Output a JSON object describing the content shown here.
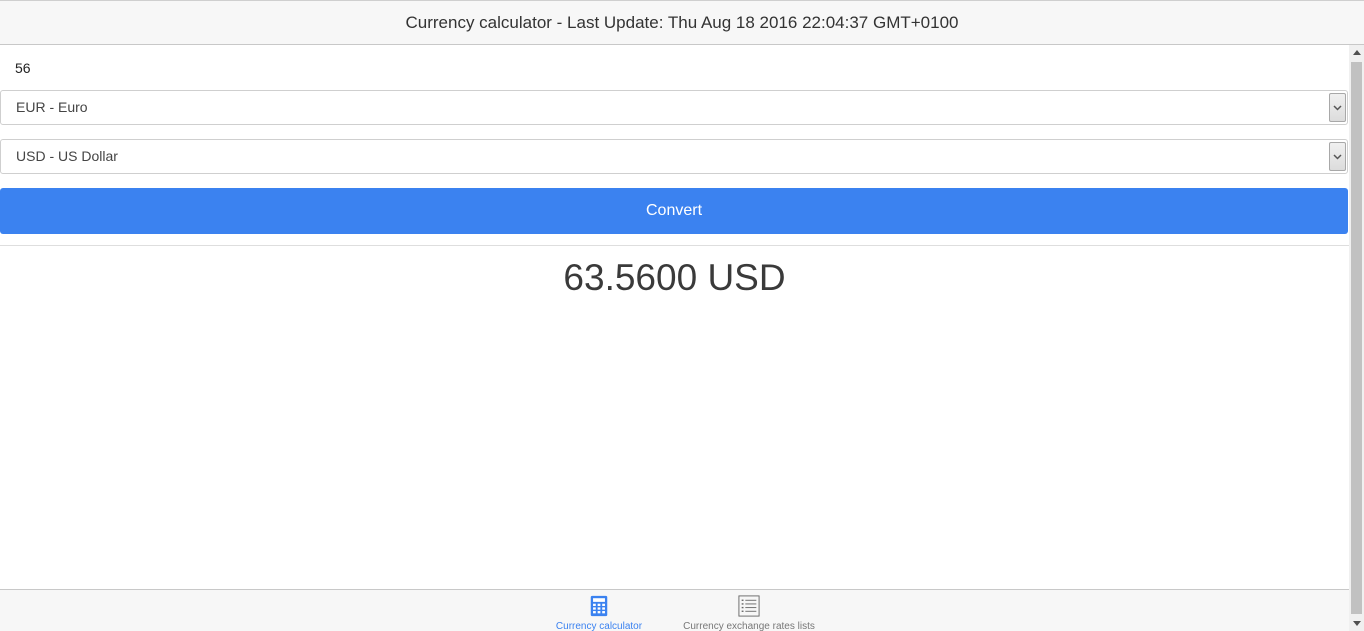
{
  "header": {
    "title": "Currency calculator - Last Update: Thu Aug 18 2016 22:04:37 GMT+0100"
  },
  "form": {
    "amount_value": "56",
    "from_currency": "EUR - Euro",
    "to_currency": "USD - US Dollar",
    "convert_label": "Convert"
  },
  "result": {
    "text": "63.5600 USD"
  },
  "tabbar": {
    "tabs": [
      {
        "label": "Currency calculator",
        "icon": "calculator-icon",
        "active": true
      },
      {
        "label": "Currency exchange rates lists",
        "icon": "list-icon",
        "active": false
      }
    ]
  },
  "colors": {
    "accent": "#3b82f0",
    "header_bg": "#f7f7f7",
    "text": "#333333"
  }
}
